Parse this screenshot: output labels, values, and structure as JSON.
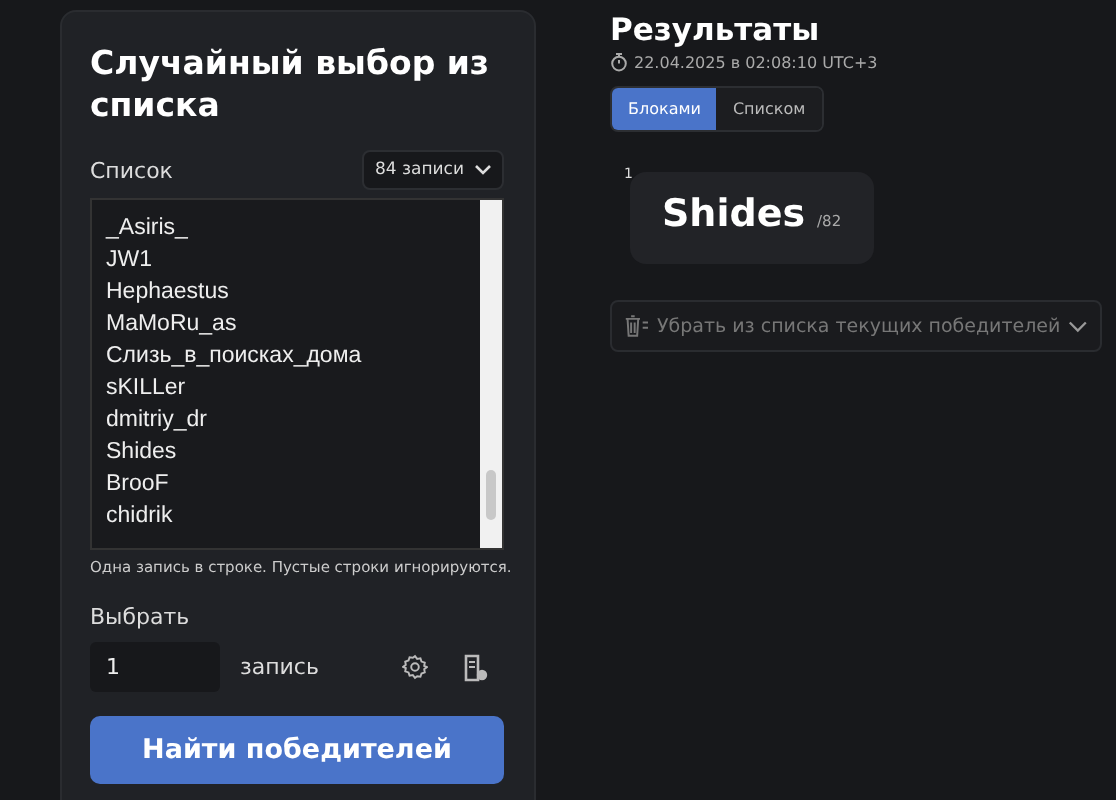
{
  "title": "Случайный выбор из списка",
  "list": {
    "label": "Список",
    "count": "84 записи",
    "entries": [
      "_Asiris_",
      "JW1",
      "Hephaestus",
      "MaMoRu_as",
      "Слизь_в_поисках_дома",
      "sKILLer",
      "dmitriy_dr",
      "Shides",
      "BrooF",
      "chidrik"
    ],
    "hint": "Одна запись в строке. Пустые строки игнорируются."
  },
  "pick": {
    "label": "Выбрать",
    "value": "1",
    "unit": "запись"
  },
  "submit": "Найти победителей",
  "results": {
    "title": "Результаты",
    "timestamp": "22.04.2025 в 02:08:10 UTC+3",
    "tabs": [
      {
        "label": "Блоками",
        "selected": true
      },
      {
        "label": "Списком",
        "selected": false
      }
    ],
    "winners": [
      {
        "rank": "1",
        "name": "Shides",
        "total": "/82"
      }
    ],
    "remove": "Убрать из списка текущих победителей"
  }
}
